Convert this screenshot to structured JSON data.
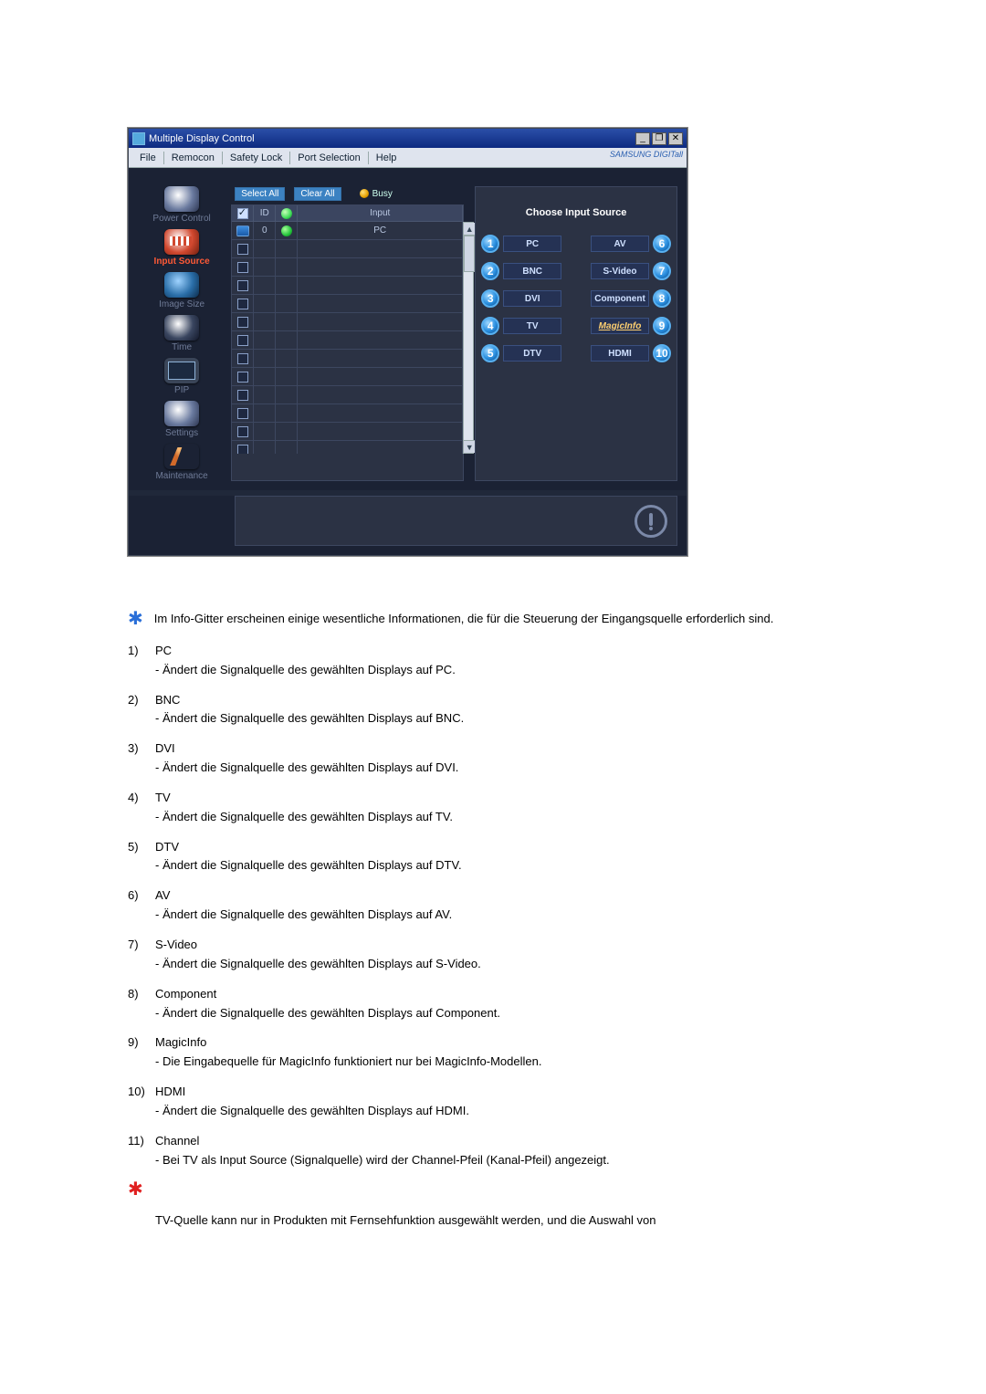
{
  "window": {
    "title": "Multiple Display Control",
    "min": "_",
    "restore": "❐",
    "close": "✕"
  },
  "menu": {
    "file": "File",
    "remocon": "Remocon",
    "safety": "Safety Lock",
    "port": "Port Selection",
    "help": "Help",
    "brand": "SAMSUNG DIGITall"
  },
  "sidebar": {
    "power": "Power Control",
    "input": "Input Source",
    "image": "Image Size",
    "time": "Time",
    "pip": "PIP",
    "settings": "Settings",
    "maint": "Maintenance"
  },
  "toolbar": {
    "selectAll": "Select All",
    "clearAll": "Clear All",
    "busy": "Busy"
  },
  "gridHeaders": {
    "id": "ID",
    "input": "Input"
  },
  "row0": {
    "id": "0",
    "input": "PC"
  },
  "panel": {
    "title": "Choose Input Source",
    "n1": "1",
    "b1": "PC",
    "n6": "6",
    "b6": "AV",
    "n2": "2",
    "b2": "BNC",
    "n7": "7",
    "b7": "S-Video",
    "n3": "3",
    "b3": "DVI",
    "n8": "8",
    "b8": "Component",
    "n4": "4",
    "b4": "TV",
    "n9": "9",
    "b9": "MagicInfo",
    "n5": "5",
    "b5": "DTV",
    "n10": "10",
    "b10": "HDMI"
  },
  "doc": {
    "intro": "Im Info-Gitter erscheinen einige wesentliche Informationen, die für die Steuerung der Eingangsquelle erforderlich sind.",
    "items": [
      {
        "n": "1)",
        "t": "PC",
        "d": "- Ändert die Signalquelle des gewählten Displays auf PC."
      },
      {
        "n": "2)",
        "t": "BNC",
        "d": "- Ändert die Signalquelle des gewählten Displays auf BNC."
      },
      {
        "n": "3)",
        "t": "DVI",
        "d": "- Ändert die Signalquelle des gewählten Displays auf DVI."
      },
      {
        "n": "4)",
        "t": "TV",
        "d": "- Ändert die Signalquelle des gewählten Displays auf TV."
      },
      {
        "n": "5)",
        "t": "DTV",
        "d": "- Ändert die Signalquelle des gewählten Displays auf DTV."
      },
      {
        "n": "6)",
        "t": "AV",
        "d": "- Ändert die Signalquelle des gewählten Displays auf AV."
      },
      {
        "n": "7)",
        "t": "S-Video",
        "d": "- Ändert die Signalquelle des gewählten Displays auf S-Video."
      },
      {
        "n": "8)",
        "t": "Component",
        "d": "- Ändert die Signalquelle des gewählten Displays auf Component."
      },
      {
        "n": "9)",
        "t": "MagicInfo",
        "d": "- Die Eingabequelle für MagicInfo funktioniert nur bei MagicInfo-Modellen."
      },
      {
        "n": "10)",
        "t": "HDMI",
        "d": "- Ändert die Signalquelle des gewählten Displays auf HDMI."
      },
      {
        "n": "11)",
        "t": "Channel",
        "d": "- Bei TV als Input Source (Signalquelle) wird der Channel-Pfeil (Kanal-Pfeil) angezeigt."
      }
    ],
    "redNote": "TV-Quelle kann nur in Produkten mit Fernsehfunktion ausgewählt werden, und die Auswahl von"
  }
}
